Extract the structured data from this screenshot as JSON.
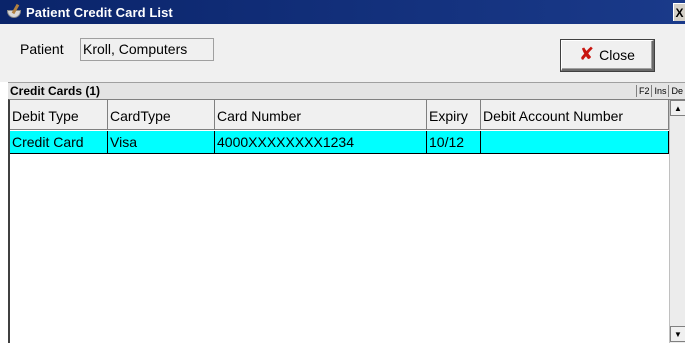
{
  "window": {
    "title": "Patient Credit Card List",
    "close_glyph": "X"
  },
  "patient": {
    "label": "Patient",
    "value": "Kroll, Computers"
  },
  "close_button": {
    "label": "Close",
    "icon": "x-icon",
    "icon_color": "#c8140e"
  },
  "section": {
    "title": "Credit Cards (1)",
    "hotkeys": [
      "F2",
      "Ins",
      "De"
    ]
  },
  "grid": {
    "columns": [
      "Debit Type",
      "CardType",
      "Card Number",
      "Expiry",
      "Debit Account Number"
    ],
    "rows": [
      {
        "debit_type": "Credit Card",
        "card_type": "Visa",
        "card_number": "4000XXXXXXXX1234",
        "expiry": "10/12",
        "debit_account_number": ""
      }
    ],
    "selected_row_color": "#00ffff"
  },
  "colors": {
    "titlebar": "#0a246a",
    "panel": "#f0f0f0"
  }
}
